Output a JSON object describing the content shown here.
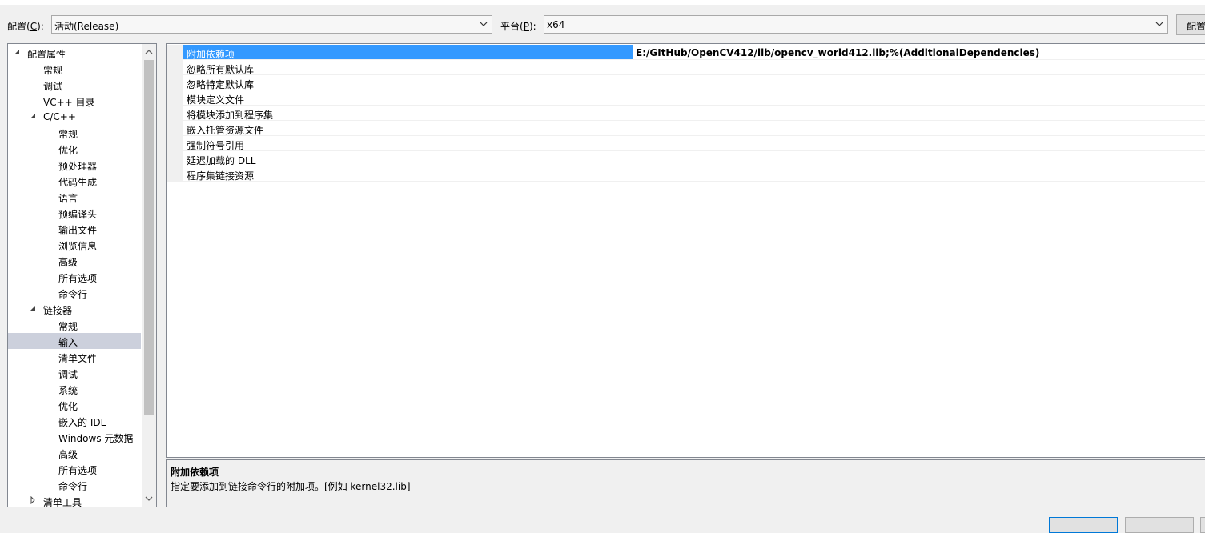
{
  "config": {
    "label": "配置",
    "accel": "C",
    "value": "活动(Release)"
  },
  "platform": {
    "label": "平台",
    "accel": "P",
    "value": "x64"
  },
  "config_manager_button": "配置管理器(O)...",
  "tree": {
    "items": [
      {
        "label": "配置属性",
        "level": 0,
        "expander": "expanded"
      },
      {
        "label": "常规",
        "level": 1
      },
      {
        "label": "调试",
        "level": 1
      },
      {
        "label": "VC++ 目录",
        "level": 1
      },
      {
        "label": "C/C++",
        "level": 1,
        "expander": "expanded"
      },
      {
        "label": "常规",
        "level": 2
      },
      {
        "label": "优化",
        "level": 2
      },
      {
        "label": "预处理器",
        "level": 2
      },
      {
        "label": "代码生成",
        "level": 2
      },
      {
        "label": "语言",
        "level": 2
      },
      {
        "label": "预编译头",
        "level": 2
      },
      {
        "label": "输出文件",
        "level": 2
      },
      {
        "label": "浏览信息",
        "level": 2
      },
      {
        "label": "高级",
        "level": 2
      },
      {
        "label": "所有选项",
        "level": 2
      },
      {
        "label": "命令行",
        "level": 2
      },
      {
        "label": "链接器",
        "level": 1,
        "expander": "expanded"
      },
      {
        "label": "常规",
        "level": 2
      },
      {
        "label": "输入",
        "level": 2,
        "selected": true
      },
      {
        "label": "清单文件",
        "level": 2
      },
      {
        "label": "调试",
        "level": 2
      },
      {
        "label": "系统",
        "level": 2
      },
      {
        "label": "优化",
        "level": 2
      },
      {
        "label": "嵌入的 IDL",
        "level": 2
      },
      {
        "label": "Windows 元数据",
        "level": 2
      },
      {
        "label": "高级",
        "level": 2
      },
      {
        "label": "所有选项",
        "level": 2
      },
      {
        "label": "命令行",
        "level": 2
      },
      {
        "label": "清单工具",
        "level": 1,
        "expander": "collapsed"
      }
    ]
  },
  "properties": [
    {
      "name": "附加依赖项",
      "value": "E:/GItHub/OpenCV412/lib/opencv_world412.lib;%(AdditionalDependencies)",
      "selected": true
    },
    {
      "name": "忽略所有默认库",
      "value": ""
    },
    {
      "name": "忽略特定默认库",
      "value": ""
    },
    {
      "name": "模块定义文件",
      "value": ""
    },
    {
      "name": "将模块添加到程序集",
      "value": ""
    },
    {
      "name": "嵌入托管资源文件",
      "value": ""
    },
    {
      "name": "强制符号引用",
      "value": ""
    },
    {
      "name": "延迟加载的 DLL",
      "value": ""
    },
    {
      "name": "程序集链接资源",
      "value": ""
    }
  ],
  "description": {
    "title": "附加依赖项",
    "text": "指定要添加到链接命令行的附加项。[例如 kernel32.lib]"
  },
  "colors": {
    "selection_focus": "#3399ff",
    "selection_inactive": "#ccd0dc",
    "window_bg": "#f0f0f0",
    "border": "#828790"
  },
  "icons": [
    "chevron-down-icon",
    "expand-triangle-icon",
    "collapse-triangle-icon",
    "scroll-up-icon",
    "scroll-down-icon"
  ]
}
